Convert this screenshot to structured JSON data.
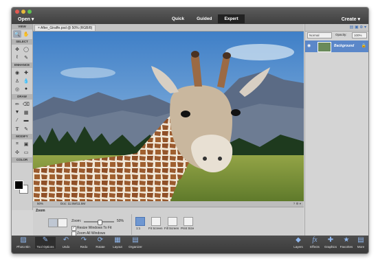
{
  "menu": {
    "open": "Open",
    "create": "Create"
  },
  "modes": [
    {
      "label": "Quick",
      "active": false
    },
    {
      "label": "Guided",
      "active": false
    },
    {
      "label": "Expert",
      "active": true
    }
  ],
  "toolbox": {
    "sections": [
      "VIEW",
      "SELECT",
      "ENHANCE",
      "DRAW",
      "MODIFY",
      "COLOR"
    ]
  },
  "document": {
    "tab_label": "After_Giraffe.psd @ 50% (RGB/8)",
    "zoom": "50%",
    "doc_info": "Doc: 11.5M/11.5M"
  },
  "tool_options": {
    "title": "Zoom",
    "zoom_label": "Zoom:",
    "zoom_value": "50%",
    "zoom_level": 0.5,
    "resize_windows": "Resize Windows To Fit",
    "resize_checked": true,
    "zoom_all": "Zoom All Windows",
    "zoom_all_checked": false,
    "view_buttons": [
      "1:1",
      "Fit Screen",
      "Fill Screen",
      "Print Size"
    ]
  },
  "layers": {
    "blend_mode": "Normal",
    "opacity_label": "Opacity:",
    "opacity_value": "100%",
    "layer_name": "Background"
  },
  "bottom_left": [
    {
      "label": "Photo Bin",
      "icon": "photo-bin-icon"
    },
    {
      "label": "Tool Options",
      "icon": "tool-options-icon"
    },
    {
      "label": "Undo",
      "icon": "undo-icon"
    },
    {
      "label": "Redo",
      "icon": "redo-icon"
    },
    {
      "label": "Rotate",
      "icon": "rotate-icon"
    },
    {
      "label": "Layout",
      "icon": "layout-icon"
    },
    {
      "label": "Organizer",
      "icon": "organizer-icon"
    }
  ],
  "bottom_right": [
    {
      "label": "Layers",
      "icon": "layers-icon"
    },
    {
      "label": "Effects",
      "icon": "effects-icon"
    },
    {
      "label": "Graphics",
      "icon": "graphics-icon"
    },
    {
      "label": "Favorites",
      "icon": "favorites-icon"
    },
    {
      "label": "More",
      "icon": "more-icon"
    }
  ],
  "colors": {
    "accent": "#6f97d1",
    "active_mode": "#222222"
  }
}
